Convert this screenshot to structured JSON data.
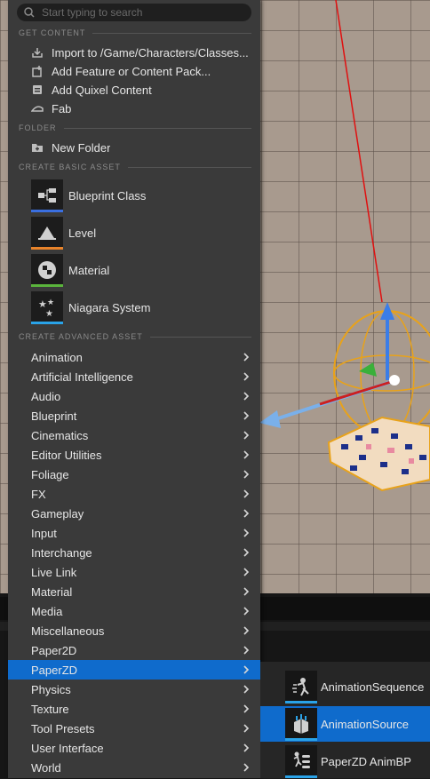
{
  "search": {
    "placeholder": "Start typing to search"
  },
  "sections": {
    "get_content": "GET CONTENT",
    "folder": "FOLDER",
    "create_basic": "CREATE BASIC ASSET",
    "create_advanced": "CREATE ADVANCED ASSET"
  },
  "get_content": [
    {
      "label": "Import to /Game/Characters/Classes...",
      "icon": "import-icon"
    },
    {
      "label": "Add Feature or Content Pack...",
      "icon": "content-pack-icon"
    },
    {
      "label": "Add Quixel Content",
      "icon": "quixel-icon"
    },
    {
      "label": "Fab",
      "icon": "fab-icon"
    }
  ],
  "folder": [
    {
      "label": "New Folder",
      "icon": "new-folder-icon"
    }
  ],
  "basic_assets": [
    {
      "label": "Blueprint Class",
      "icon": "blueprint-class-icon",
      "color": "#3a6fe0"
    },
    {
      "label": "Level",
      "icon": "level-icon",
      "color": "#e8832a"
    },
    {
      "label": "Material",
      "icon": "material-icon",
      "color": "#5ab43c"
    },
    {
      "label": "Niagara System",
      "icon": "niagara-icon",
      "color": "#2aa3e8"
    }
  ],
  "advanced_assets": [
    "Animation",
    "Artificial Intelligence",
    "Audio",
    "Blueprint",
    "Cinematics",
    "Editor Utilities",
    "Foliage",
    "FX",
    "Gameplay",
    "Input",
    "Interchange",
    "Live Link",
    "Material",
    "Media",
    "Miscellaneous",
    "Paper2D",
    "PaperZD",
    "Physics",
    "Texture",
    "Tool Presets",
    "User Interface",
    "World"
  ],
  "selected_advanced": "PaperZD",
  "submenu": [
    {
      "label": "AnimationSequence",
      "icon": "animation-sequence-icon",
      "selected": false
    },
    {
      "label": "AnimationSource",
      "icon": "animation-source-icon",
      "selected": true
    },
    {
      "label": "PaperZD AnimBP",
      "icon": "paperzd-animbp-icon",
      "selected": false
    }
  ],
  "colors": {
    "accent": "#0f6bcc",
    "menu_bg": "#3a3a3a"
  }
}
